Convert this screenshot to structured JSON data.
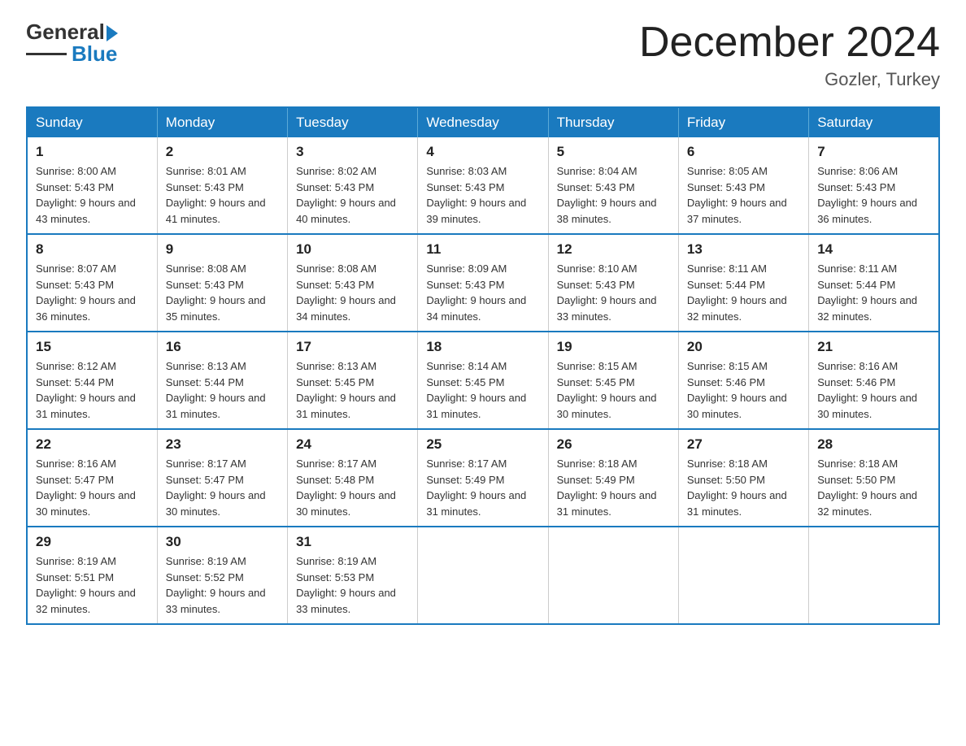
{
  "header": {
    "logo_general": "General",
    "logo_blue": "Blue",
    "month_title": "December 2024",
    "location": "Gozler, Turkey"
  },
  "days_of_week": [
    "Sunday",
    "Monday",
    "Tuesday",
    "Wednesday",
    "Thursday",
    "Friday",
    "Saturday"
  ],
  "weeks": [
    [
      {
        "day": 1,
        "sunrise": "8:00 AM",
        "sunset": "5:43 PM",
        "daylight": "9 hours and 43 minutes."
      },
      {
        "day": 2,
        "sunrise": "8:01 AM",
        "sunset": "5:43 PM",
        "daylight": "9 hours and 41 minutes."
      },
      {
        "day": 3,
        "sunrise": "8:02 AM",
        "sunset": "5:43 PM",
        "daylight": "9 hours and 40 minutes."
      },
      {
        "day": 4,
        "sunrise": "8:03 AM",
        "sunset": "5:43 PM",
        "daylight": "9 hours and 39 minutes."
      },
      {
        "day": 5,
        "sunrise": "8:04 AM",
        "sunset": "5:43 PM",
        "daylight": "9 hours and 38 minutes."
      },
      {
        "day": 6,
        "sunrise": "8:05 AM",
        "sunset": "5:43 PM",
        "daylight": "9 hours and 37 minutes."
      },
      {
        "day": 7,
        "sunrise": "8:06 AM",
        "sunset": "5:43 PM",
        "daylight": "9 hours and 36 minutes."
      }
    ],
    [
      {
        "day": 8,
        "sunrise": "8:07 AM",
        "sunset": "5:43 PM",
        "daylight": "9 hours and 36 minutes."
      },
      {
        "day": 9,
        "sunrise": "8:08 AM",
        "sunset": "5:43 PM",
        "daylight": "9 hours and 35 minutes."
      },
      {
        "day": 10,
        "sunrise": "8:08 AM",
        "sunset": "5:43 PM",
        "daylight": "9 hours and 34 minutes."
      },
      {
        "day": 11,
        "sunrise": "8:09 AM",
        "sunset": "5:43 PM",
        "daylight": "9 hours and 34 minutes."
      },
      {
        "day": 12,
        "sunrise": "8:10 AM",
        "sunset": "5:43 PM",
        "daylight": "9 hours and 33 minutes."
      },
      {
        "day": 13,
        "sunrise": "8:11 AM",
        "sunset": "5:44 PM",
        "daylight": "9 hours and 32 minutes."
      },
      {
        "day": 14,
        "sunrise": "8:11 AM",
        "sunset": "5:44 PM",
        "daylight": "9 hours and 32 minutes."
      }
    ],
    [
      {
        "day": 15,
        "sunrise": "8:12 AM",
        "sunset": "5:44 PM",
        "daylight": "9 hours and 31 minutes."
      },
      {
        "day": 16,
        "sunrise": "8:13 AM",
        "sunset": "5:44 PM",
        "daylight": "9 hours and 31 minutes."
      },
      {
        "day": 17,
        "sunrise": "8:13 AM",
        "sunset": "5:45 PM",
        "daylight": "9 hours and 31 minutes."
      },
      {
        "day": 18,
        "sunrise": "8:14 AM",
        "sunset": "5:45 PM",
        "daylight": "9 hours and 31 minutes."
      },
      {
        "day": 19,
        "sunrise": "8:15 AM",
        "sunset": "5:45 PM",
        "daylight": "9 hours and 30 minutes."
      },
      {
        "day": 20,
        "sunrise": "8:15 AM",
        "sunset": "5:46 PM",
        "daylight": "9 hours and 30 minutes."
      },
      {
        "day": 21,
        "sunrise": "8:16 AM",
        "sunset": "5:46 PM",
        "daylight": "9 hours and 30 minutes."
      }
    ],
    [
      {
        "day": 22,
        "sunrise": "8:16 AM",
        "sunset": "5:47 PM",
        "daylight": "9 hours and 30 minutes."
      },
      {
        "day": 23,
        "sunrise": "8:17 AM",
        "sunset": "5:47 PM",
        "daylight": "9 hours and 30 minutes."
      },
      {
        "day": 24,
        "sunrise": "8:17 AM",
        "sunset": "5:48 PM",
        "daylight": "9 hours and 30 minutes."
      },
      {
        "day": 25,
        "sunrise": "8:17 AM",
        "sunset": "5:49 PM",
        "daylight": "9 hours and 31 minutes."
      },
      {
        "day": 26,
        "sunrise": "8:18 AM",
        "sunset": "5:49 PM",
        "daylight": "9 hours and 31 minutes."
      },
      {
        "day": 27,
        "sunrise": "8:18 AM",
        "sunset": "5:50 PM",
        "daylight": "9 hours and 31 minutes."
      },
      {
        "day": 28,
        "sunrise": "8:18 AM",
        "sunset": "5:50 PM",
        "daylight": "9 hours and 32 minutes."
      }
    ],
    [
      {
        "day": 29,
        "sunrise": "8:19 AM",
        "sunset": "5:51 PM",
        "daylight": "9 hours and 32 minutes."
      },
      {
        "day": 30,
        "sunrise": "8:19 AM",
        "sunset": "5:52 PM",
        "daylight": "9 hours and 33 minutes."
      },
      {
        "day": 31,
        "sunrise": "8:19 AM",
        "sunset": "5:53 PM",
        "daylight": "9 hours and 33 minutes."
      },
      null,
      null,
      null,
      null
    ]
  ]
}
